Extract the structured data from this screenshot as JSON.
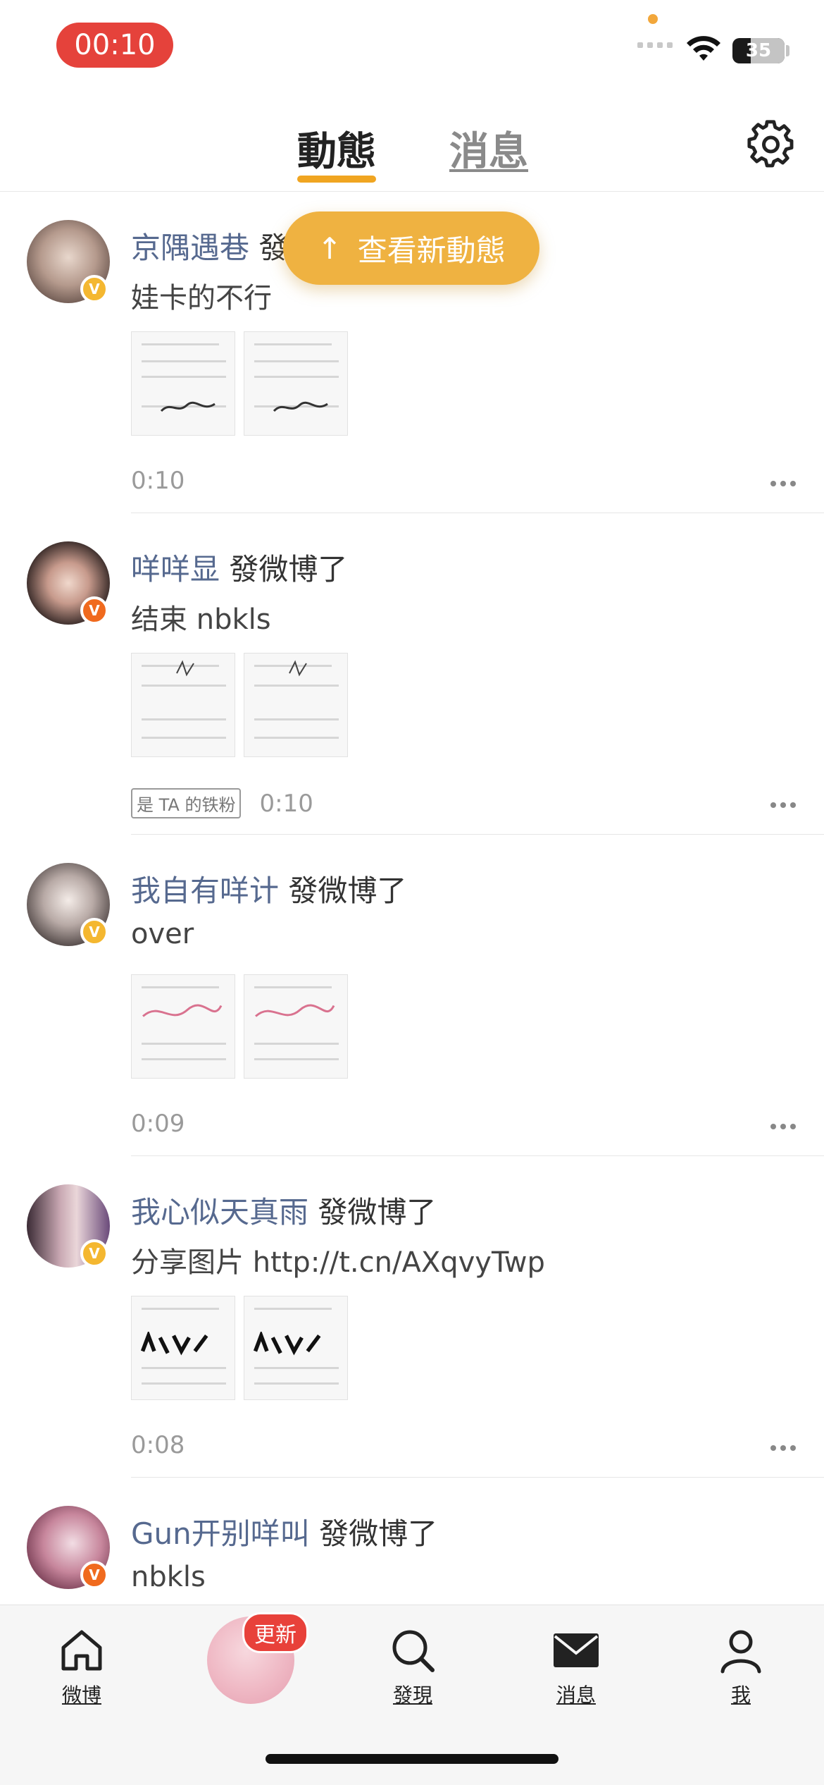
{
  "status_bar": {
    "time": "00:10",
    "battery": "35"
  },
  "header": {
    "tabs": [
      {
        "label": "動態",
        "active": true
      },
      {
        "label": "消息",
        "active": false
      }
    ]
  },
  "new_posts_pill": {
    "label": "查看新動態",
    "arrow": "↑"
  },
  "posts": [
    {
      "username": "京隅遇巷",
      "action": "發",
      "text": "娃卡的不行",
      "time": "0:10",
      "badge": "",
      "verify": "v-yellow"
    },
    {
      "username": "咩咩显",
      "action": "發微博了",
      "text": "结束 nbkls",
      "time": "0:10",
      "badge": "是 TA 的铁粉",
      "verify": "v-orange"
    },
    {
      "username": "我自有咩计",
      "action": "發微博了",
      "text": "over",
      "time": "0:09",
      "badge": "",
      "verify": "v-yellow"
    },
    {
      "username": "我心似天真雨",
      "action": "發微博了",
      "text": "分享图片  http://t.cn/AXqvyTwp",
      "time": "0:08",
      "badge": "",
      "verify": "v-yellow"
    },
    {
      "username": "Gun开别咩叫",
      "action": "發微博了",
      "text": "nbkls",
      "time": "",
      "badge": "",
      "verify": "v-orange"
    }
  ],
  "tabbar": {
    "items": [
      {
        "label": "微博"
      },
      {
        "label": "發現"
      },
      {
        "label": "消息"
      },
      {
        "label": "我"
      }
    ],
    "update_badge": "更新"
  },
  "colors": {
    "accent": "#efb241",
    "username": "#56698f",
    "red": "#e5423b"
  }
}
